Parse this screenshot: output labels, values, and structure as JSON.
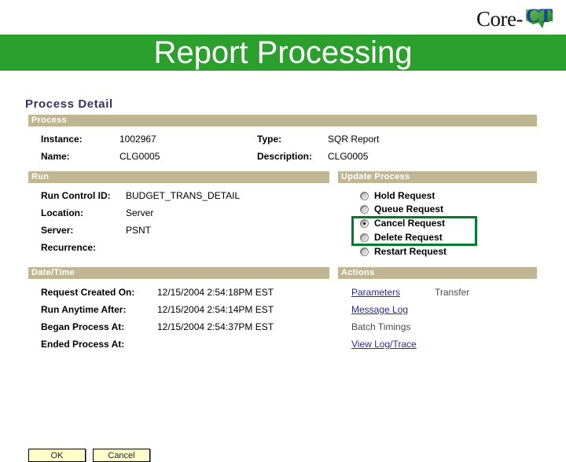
{
  "slide": {
    "title": "Report Processing",
    "logo": {
      "wordmark": "Core-",
      "mark_letters": "CT",
      "icon": "connecticut-state-shape",
      "brand_green": "#2ca02c",
      "brand_blue": "#1b3fa0"
    },
    "band_color": "#2ca02c"
  },
  "screen": {
    "page_title": "Process Detail",
    "section_bar_color": "#c0b693",
    "sections": {
      "process": {
        "heading": "Process",
        "fields": [
          {
            "label": "Instance:",
            "value": "1002967"
          },
          {
            "label": "Name:",
            "value": "CLG0005"
          },
          {
            "label": "Type:",
            "value": "SQR Report"
          },
          {
            "label": "Description:",
            "value": "CLG0005"
          }
        ]
      },
      "run": {
        "heading": "Run",
        "fields": [
          {
            "label": "Run Control ID:",
            "value": "BUDGET_TRANS_DETAIL"
          },
          {
            "label": "Location:",
            "value": "Server"
          },
          {
            "label": "Server:",
            "value": "PSNT"
          },
          {
            "label": "Recurrence:",
            "value": ""
          }
        ]
      },
      "update_process": {
        "heading": "Update Process",
        "options": [
          {
            "label": "Hold Request",
            "selected": false
          },
          {
            "label": "Queue Request",
            "selected": false
          },
          {
            "label": "Cancel Request",
            "selected": true
          },
          {
            "label": "Delete Request",
            "selected": false
          },
          {
            "label": "Restart Request",
            "selected": false
          }
        ],
        "highlight_color": "#007a2f"
      },
      "date_time": {
        "heading": "Date/Time",
        "fields": [
          {
            "label": "Request Created On:",
            "value": "12/15/2004  2:54:18PM EST"
          },
          {
            "label": "Run Anytime After:",
            "value": "12/15/2004  2:54:14PM EST"
          },
          {
            "label": "Began Process At:",
            "value": "12/15/2004  2:54:37PM EST"
          },
          {
            "label": "Ended Process At:",
            "value": ""
          }
        ]
      },
      "actions": {
        "heading": "Actions",
        "items": [
          {
            "label": "Parameters",
            "enabled": true
          },
          {
            "label": "Transfer",
            "enabled": false
          },
          {
            "label": "Message Log",
            "enabled": true
          },
          {
            "label": "Batch Timings",
            "enabled": false
          },
          {
            "label": "View Log/Trace",
            "enabled": true
          }
        ]
      }
    },
    "buttons": {
      "ok": "OK",
      "cancel": "Cancel"
    }
  }
}
